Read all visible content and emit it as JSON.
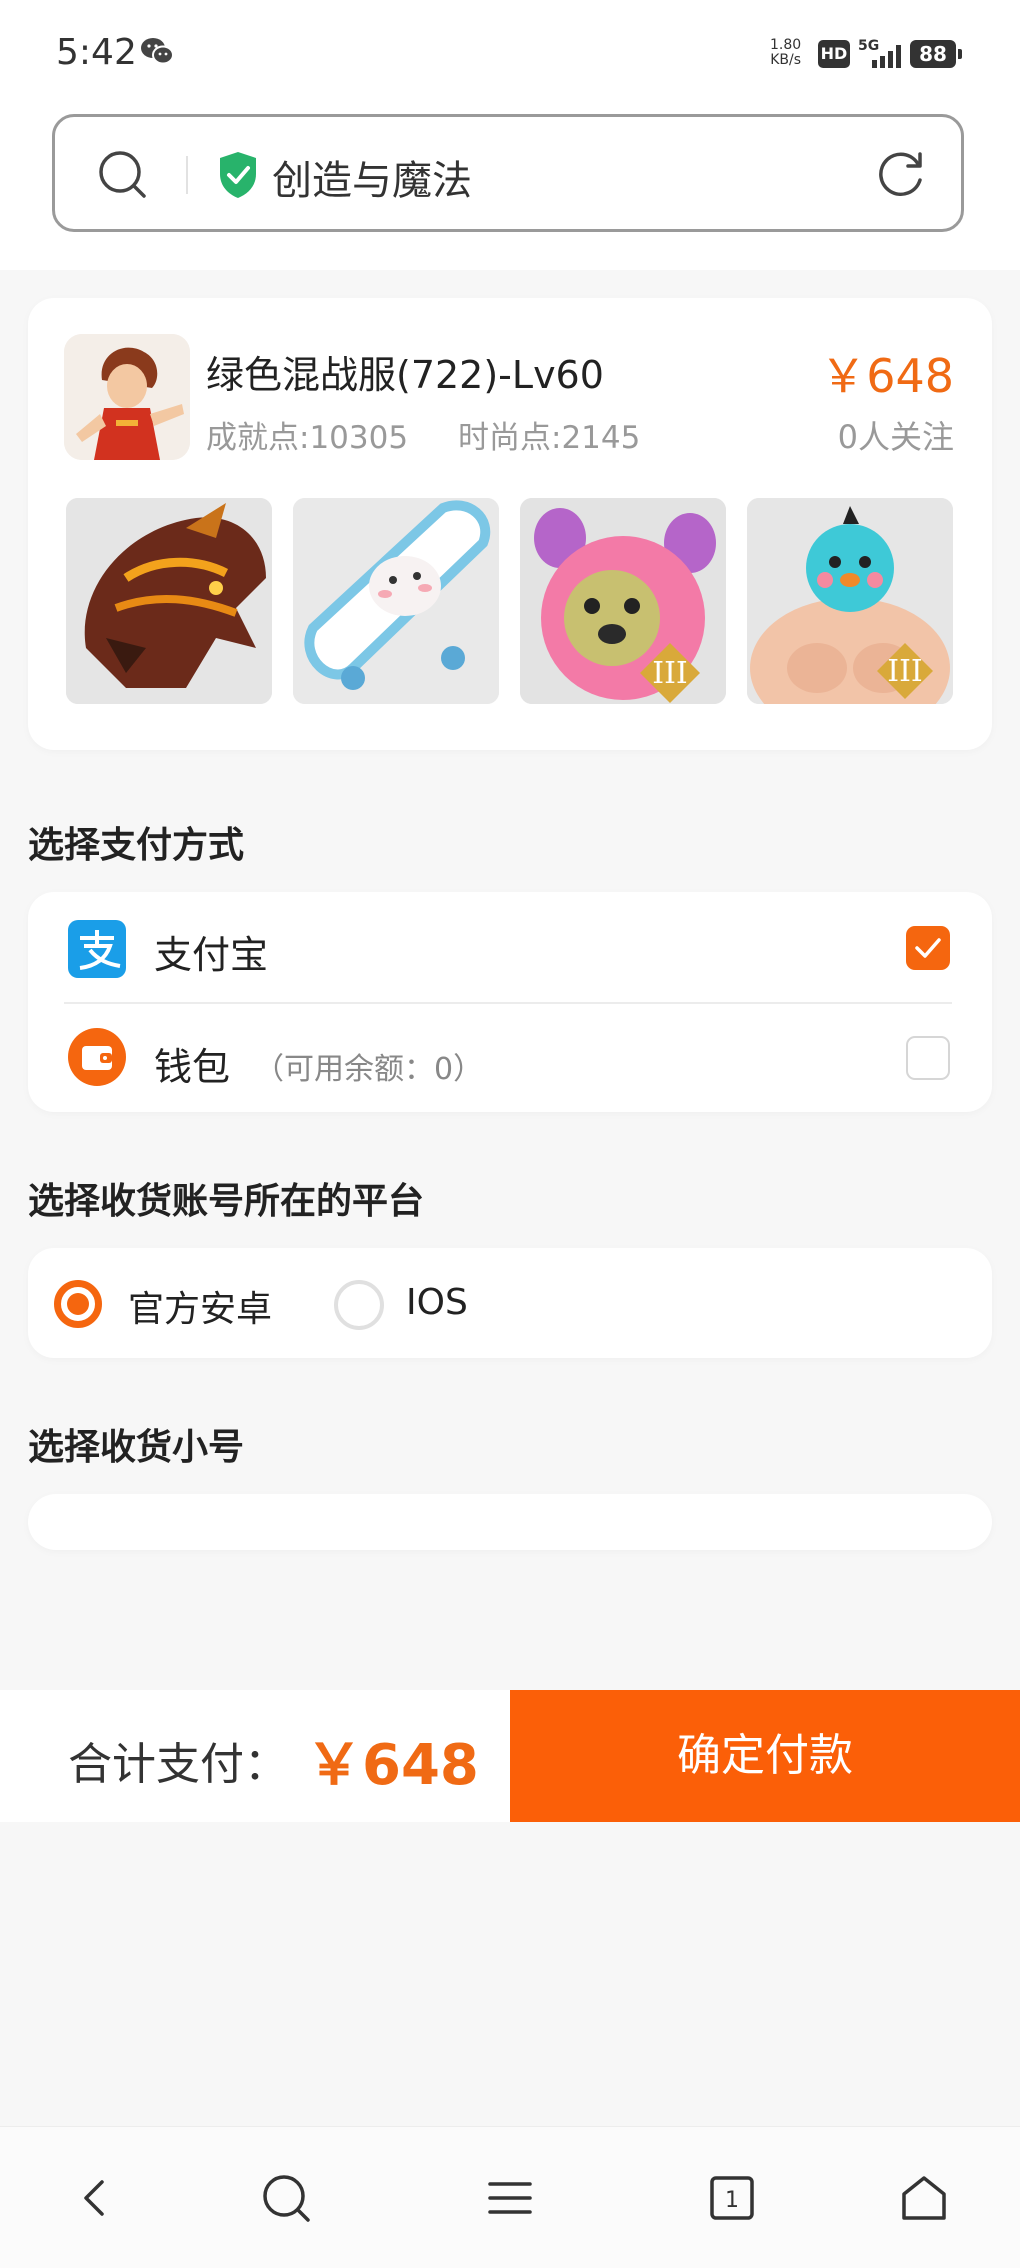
{
  "status_bar": {
    "time": "5:42",
    "speed_value": "1.80",
    "speed_unit": "KB/s",
    "hd": "HD",
    "network": "5G",
    "battery": "88"
  },
  "header": {
    "site_title": "创造与魔法"
  },
  "item": {
    "name": "绿色混战服(722)-Lv60",
    "achievement": "成就点:10305",
    "fashion": "时尚点:2145",
    "price": "￥648",
    "followers": "0人关注",
    "thumb_badges": [
      "",
      "",
      "III",
      "III"
    ]
  },
  "payment": {
    "section_title": "选择支付方式",
    "alipay_label": "支付宝",
    "wallet_label": "钱包",
    "wallet_balance": "（可用余额：0）"
  },
  "platform": {
    "section_title": "选择收货账号所在的平台",
    "option_android": "官方安卓",
    "option_ios": "IOS"
  },
  "receiver": {
    "section_title": "选择收货小号"
  },
  "footer": {
    "total_label": "合计支付：",
    "total_amount": "￥648",
    "confirm_label": "确定付款"
  },
  "bottom_nav": {
    "tab_count": "1"
  },
  "colors": {
    "accent": "#f5660f",
    "price": "#f06a14",
    "alipay": "#1a9ee8",
    "shield": "#28b36b"
  },
  "icons": [
    "wechat-icon",
    "search-icon",
    "shield-icon",
    "refresh-icon",
    "alipay-icon",
    "wallet-icon",
    "back-icon",
    "search-nav-icon",
    "menu-icon",
    "tabs-icon",
    "home-icon"
  ]
}
